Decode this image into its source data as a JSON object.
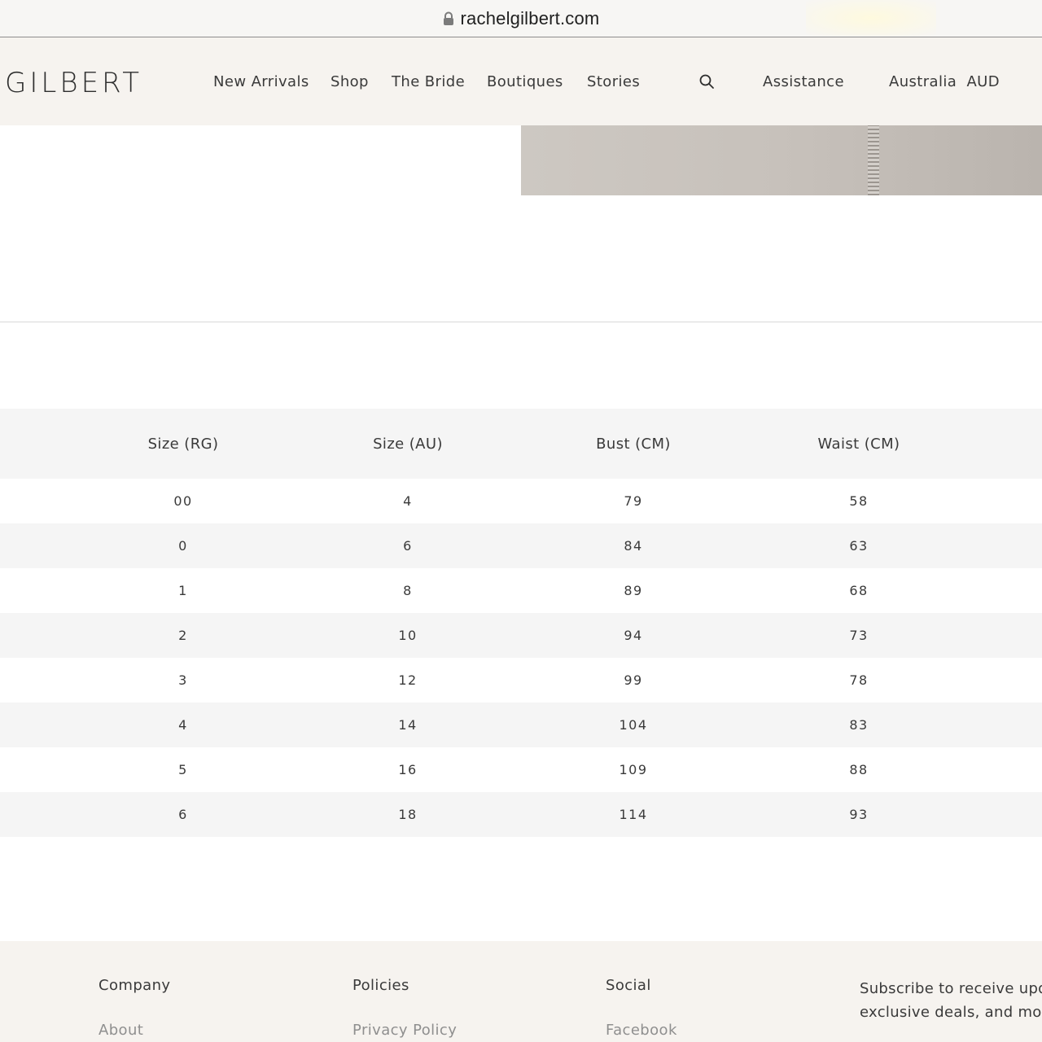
{
  "browser": {
    "url": "rachelgilbert.com"
  },
  "header": {
    "logo": "GILBERT",
    "nav": [
      "New Arrivals",
      "Shop",
      "The Bride",
      "Boutiques",
      "Stories"
    ],
    "assistance": "Assistance",
    "region": "Australia  AUD",
    "icons": {
      "search": "search-icon",
      "lock": "lock-icon"
    }
  },
  "size_table": {
    "headers": [
      "Size (RG)",
      "Size (AU)",
      "Bust (CM)",
      "Waist (CM)"
    ],
    "rows": [
      [
        "00",
        "4",
        "79",
        "58"
      ],
      [
        "0",
        "6",
        "84",
        "63"
      ],
      [
        "1",
        "8",
        "89",
        "68"
      ],
      [
        "2",
        "10",
        "94",
        "73"
      ],
      [
        "3",
        "12",
        "99",
        "78"
      ],
      [
        "4",
        "14",
        "104",
        "83"
      ],
      [
        "5",
        "16",
        "109",
        "88"
      ],
      [
        "6",
        "18",
        "114",
        "93"
      ]
    ]
  },
  "footer": {
    "company": {
      "heading": "Company",
      "first_link": "About"
    },
    "policies": {
      "heading": "Policies",
      "first_link": "Privacy Policy"
    },
    "social": {
      "heading": "Social",
      "first_link": "Facebook"
    },
    "subscribe": {
      "line1": "Subscribe to receive upd",
      "line2": "exclusive deals, and mor"
    }
  },
  "colors": {
    "header_bg": "#f6f3ef",
    "table_stripe": "#f5f5f5",
    "text": "#3a3a3a",
    "muted_link": "#8f8f8f"
  }
}
